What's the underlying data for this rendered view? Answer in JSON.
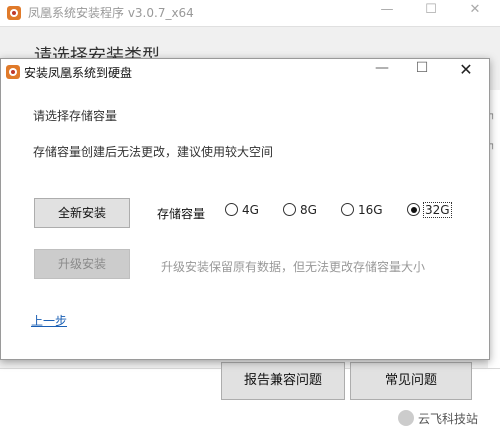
{
  "background_window": {
    "title": "凤凰系统安装程序 v3.0.7_x64",
    "heading": "请选择安装类型",
    "buttons": {
      "report": "报告兼容问题",
      "faq": "常见问题"
    }
  },
  "dialog": {
    "title": "安装凤凰系统到硬盘",
    "prompt": "请选择存储容量",
    "note": "存储容量创建后无法更改，建议使用较大空间",
    "full_install": "全新安装",
    "capacity_label": "存储容量",
    "capacity_options": [
      "4G",
      "8G",
      "16G",
      "32G"
    ],
    "selected_capacity": "32G",
    "upgrade_install": "升级安装",
    "upgrade_note": "升级安装保留原有数据，但无法更改存储容量大小",
    "back_link": "上一步"
  },
  "watermark": "云飞科技站",
  "colors": {
    "accent_link": "#1a5fb4",
    "disabled_text": "#8a8a8a"
  }
}
